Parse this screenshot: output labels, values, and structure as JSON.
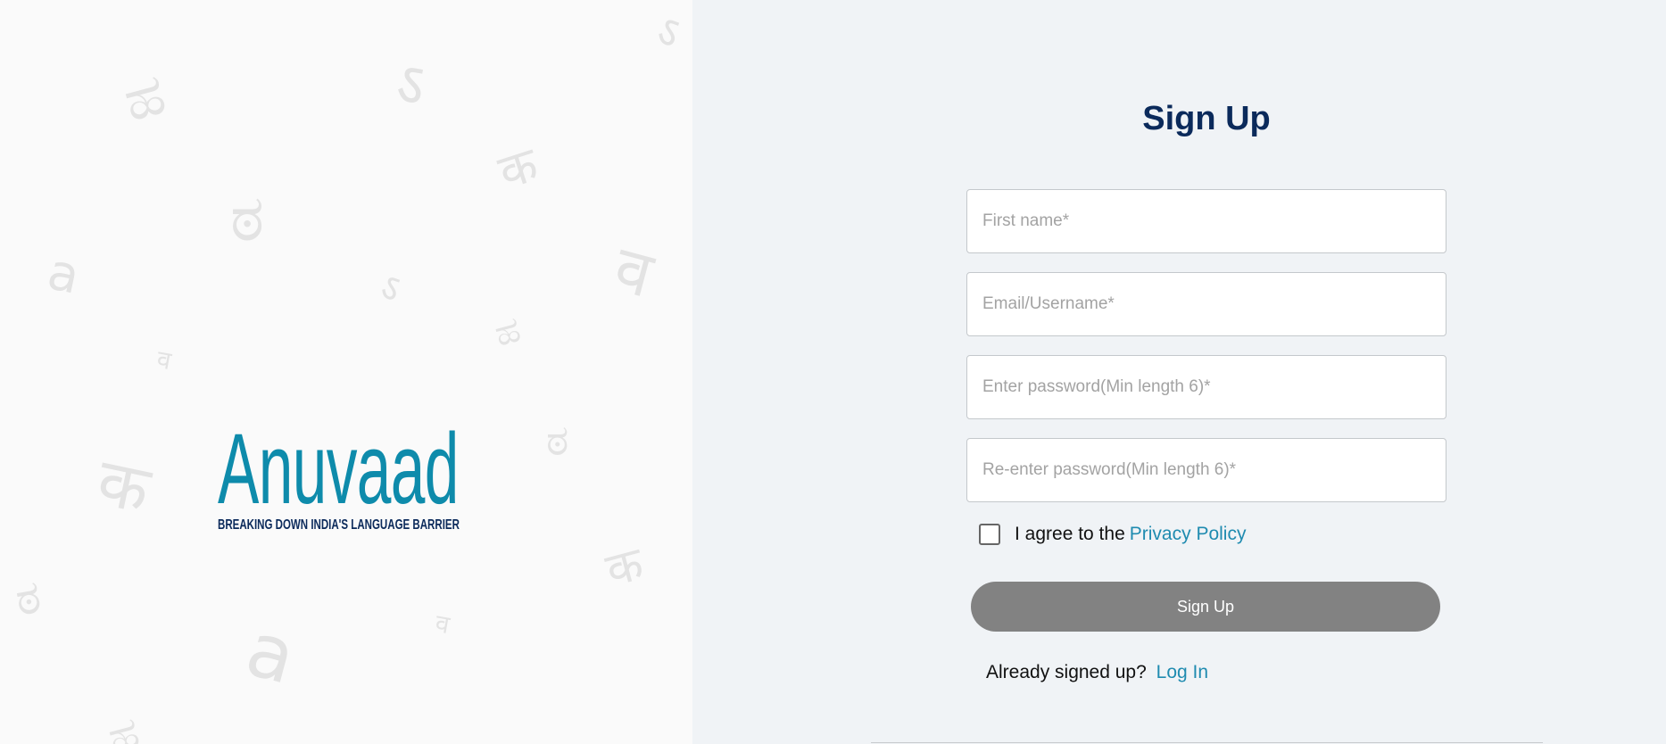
{
  "brand": {
    "name": "Anuvaad",
    "tagline": "BREAKING DOWN INDIA'S LANGUAGE BARRIER",
    "colors": {
      "logo_primary": "#0e8bab",
      "tagline": "#0b2a5b",
      "watermark": "#e3e3e3"
    }
  },
  "form": {
    "title": "Sign Up",
    "first_name_placeholder": "First name*",
    "email_placeholder": "Email/Username*",
    "password_placeholder": "Enter password(Min length 6)*",
    "confirm_password_placeholder": "Re-enter password(Min length 6)*",
    "agree_text": "I agree to the",
    "privacy_link": "Privacy Policy",
    "privacy_checked": false,
    "submit_label": "Sign Up",
    "login_prompt": "Already signed up?",
    "login_link": "Log In"
  },
  "colors": {
    "accent": "#1f8bb0",
    "title": "#0b2a5b",
    "button": "#828282",
    "right_bg": "#f0f3f6"
  }
}
